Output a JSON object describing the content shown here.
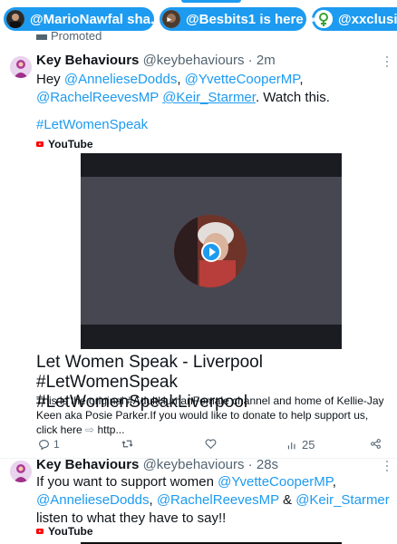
{
  "banner": {
    "pills": [
      {
        "label": "@MarioNawfal sha...",
        "badge": "▸"
      },
      {
        "label": "@Besbits1 is here",
        "badge": "◂▸"
      },
      {
        "label": "@xxclusion",
        "badge": ""
      }
    ]
  },
  "promoted": {
    "label": "Promoted"
  },
  "tweet1": {
    "name": "Key Behaviours",
    "handle": "@keybehaviours",
    "time": "2m",
    "text": {
      "hey": "Hey",
      "m1": "@AnnelieseDodds",
      "m2": "@YvetteCooperMP",
      "m3": "@RachelReevesMP",
      "m4": "@Keir_Starmer",
      "watch": ". Watch this.",
      "hashtag": "#LetWomenSpeak"
    },
    "source": "YouTube",
    "card": {
      "title": "Let Women Speak - Liverpool #LetWomenSpeak #LetWomenSpeakLiverpool",
      "description": "This is the original #AdultHumanFemale channel and home of Kellie-Jay Keen aka Posie Parker.If you would like to donate to help support us, click here",
      "link_tail": "http..."
    },
    "actions": {
      "replies": "1",
      "retweets": "",
      "likes": "",
      "views": "25"
    }
  },
  "tweet2": {
    "name": "Key Behaviours",
    "handle": "@keybehaviours",
    "time": "28s",
    "text": {
      "intro": "If you want to support women",
      "m1": "@YvetteCooperMP",
      "m2": "@AnnelieseDodds",
      "m3": "@RachelReevesMP",
      "amp": "&",
      "m4": "@Keir_Starmer",
      "outro": "listen to what they have to say!!"
    },
    "source": "YouTube"
  },
  "colors": {
    "accent": "#1d9bf0",
    "text": "#0f1419",
    "muted": "#536471",
    "youtube": "#ff0000"
  }
}
